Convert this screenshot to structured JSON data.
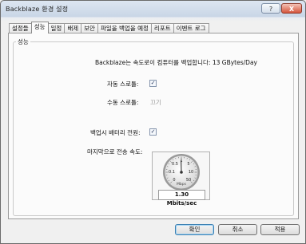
{
  "window": {
    "title": "Backblaze 환경 설정",
    "title_buttons": {
      "help": "?",
      "close": "X"
    }
  },
  "tabs": [
    {
      "label": "설정들",
      "active": false
    },
    {
      "label": "성능",
      "active": true
    },
    {
      "label": "일정",
      "active": false
    },
    {
      "label": "배제",
      "active": false
    },
    {
      "label": "보안",
      "active": false
    },
    {
      "label": "파일을 백업을 예정",
      "active": false
    },
    {
      "label": "리포트",
      "active": false
    },
    {
      "label": "이벤트 로그",
      "active": false
    }
  ],
  "performance": {
    "group_label": "성능",
    "backup_speed_text": "Backblaze는 속도로이 컴퓨터를 백업합니다: 13 GBytes/Day",
    "auto_throttle": {
      "label": "자동 스로틀:",
      "checked": true,
      "mark": "✓"
    },
    "manual_throttle": {
      "label": "수동 스로틀:",
      "value": "끄기"
    },
    "battery_backup": {
      "label": "백업시 배터리 전원:",
      "checked": true,
      "mark": "✓"
    },
    "last_transfer_label": "마지막으로 전송 속도:",
    "gauge": {
      "scale_labels": [
        "0",
        "0.1",
        "0.5",
        "1",
        "5",
        "10",
        "50"
      ],
      "units": "Mbps",
      "reading": "1.30 Mbits/sec",
      "needle_value_mbps": 1.3
    }
  },
  "buttons": {
    "ok": "확인",
    "cancel": "취소",
    "apply": "적용"
  }
}
